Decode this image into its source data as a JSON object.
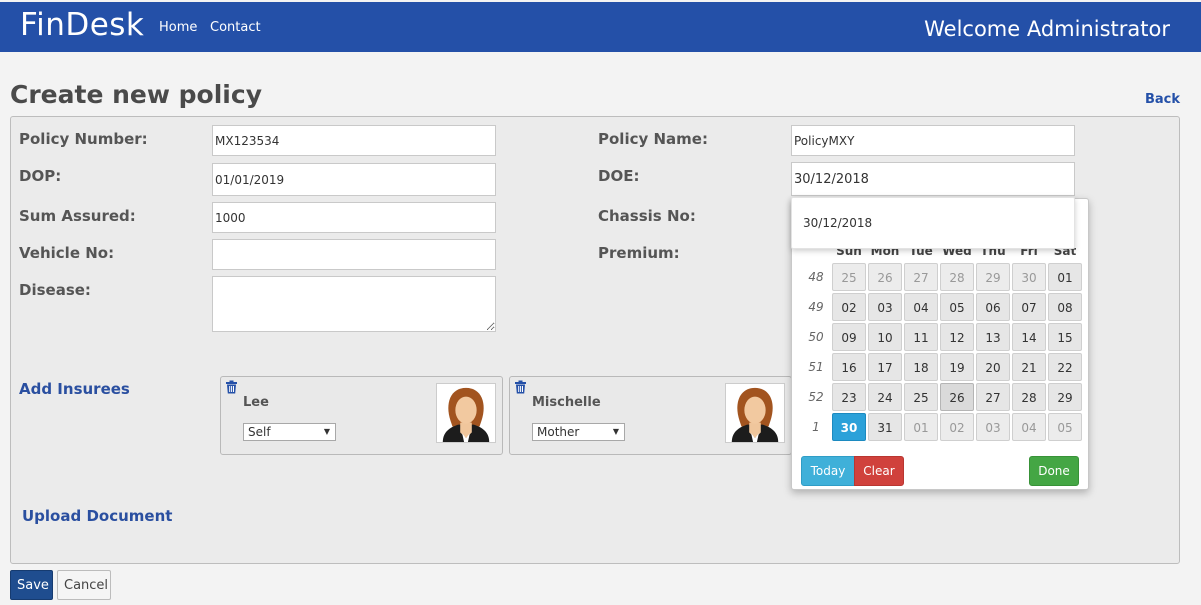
{
  "navbar": {
    "brand": "FinDesk",
    "links": [
      "Home",
      "Contact"
    ],
    "welcome": "Welcome Administrator",
    "color": "#2450a8"
  },
  "page": {
    "title": "Create new policy",
    "back_label": "Back"
  },
  "form": {
    "policy_number": {
      "label": "Policy Number:",
      "value": "MX123534"
    },
    "policy_name": {
      "label": "Policy Name:",
      "value": "PolicyMXY"
    },
    "dop": {
      "label": "DOP:",
      "value": "01/01/2019"
    },
    "doe": {
      "label": "DOE:",
      "value": "30/12/2018"
    },
    "sum_assured": {
      "label": "Sum Assured:",
      "value": "1000"
    },
    "chassis_no": {
      "label": "Chassis No:",
      "value": ""
    },
    "vehicle_no": {
      "label": "Vehicle No:",
      "value": ""
    },
    "premium": {
      "label": "Premium:",
      "value": ""
    },
    "disease": {
      "label": "Disease:",
      "value": ""
    }
  },
  "insurees": {
    "add_label": "Add Insurees",
    "cards": [
      {
        "name": "Lee",
        "relation": "Self",
        "icon": "trash-icon"
      },
      {
        "name": "Mischelle",
        "relation": "Mother",
        "icon": "trash-icon"
      }
    ]
  },
  "upload_label": "Upload Document",
  "datepicker": {
    "input_value": "30/12/2018",
    "weekdays": [
      "Sun",
      "Mon",
      "Tue",
      "Wed",
      "Thu",
      "Fri",
      "Sat"
    ],
    "weeks": [
      {
        "num": "48",
        "days": [
          "25",
          "26",
          "27",
          "28",
          "29",
          "30",
          "01"
        ]
      },
      {
        "num": "49",
        "days": [
          "02",
          "03",
          "04",
          "05",
          "06",
          "07",
          "08"
        ]
      },
      {
        "num": "50",
        "days": [
          "09",
          "10",
          "11",
          "12",
          "13",
          "14",
          "15"
        ]
      },
      {
        "num": "51",
        "days": [
          "16",
          "17",
          "18",
          "19",
          "20",
          "21",
          "22"
        ]
      },
      {
        "num": "52",
        "days": [
          "23",
          "24",
          "25",
          "26",
          "27",
          "28",
          "29"
        ]
      },
      {
        "num": "1",
        "days": [
          "30",
          "31",
          "01",
          "02",
          "03",
          "04",
          "05"
        ]
      }
    ],
    "selected_day": "30",
    "today_day": "26",
    "buttons": {
      "today": "Today",
      "clear": "Clear",
      "done": "Done"
    },
    "colors": {
      "selected": "#2ba1d9",
      "today": "#3fb0d9",
      "clear": "#d0413c",
      "done": "#44a644"
    }
  },
  "actions": {
    "save": "Save",
    "cancel": "Cancel"
  }
}
